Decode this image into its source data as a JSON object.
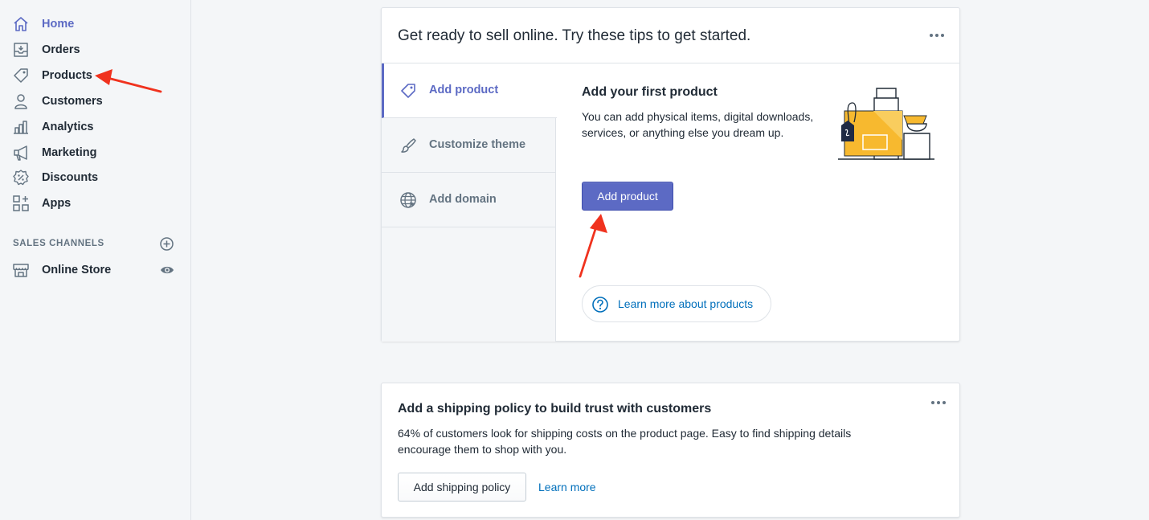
{
  "sidebar": {
    "items": [
      {
        "label": "Home",
        "icon": "home-icon",
        "active": true
      },
      {
        "label": "Orders",
        "icon": "orders-icon"
      },
      {
        "label": "Products",
        "icon": "tag-icon"
      },
      {
        "label": "Customers",
        "icon": "person-icon"
      },
      {
        "label": "Analytics",
        "icon": "bar-chart-icon"
      },
      {
        "label": "Marketing",
        "icon": "megaphone-icon"
      },
      {
        "label": "Discounts",
        "icon": "discount-icon"
      },
      {
        "label": "Apps",
        "icon": "apps-icon"
      }
    ],
    "sales_channels": {
      "title": "SALES CHANNELS",
      "items": [
        {
          "label": "Online Store",
          "icon": "store-icon"
        }
      ]
    }
  },
  "setup_card": {
    "title": "Get ready to sell online. Try these tips to get started.",
    "tabs": [
      {
        "label": "Add product",
        "icon": "tag-icon",
        "active": true
      },
      {
        "label": "Customize theme",
        "icon": "paintbrush-icon"
      },
      {
        "label": "Add domain",
        "icon": "globe-icon"
      }
    ],
    "panel": {
      "title": "Add your first product",
      "description": "You can add physical items, digital downloads, services, or anything else you dream up.",
      "primary_button": "Add product",
      "learn_more": "Learn more about products"
    }
  },
  "shipping_card": {
    "title": "Add a shipping policy to build trust with customers",
    "description": "64% of customers look for shipping costs on the product page. Easy to find shipping details encourage them to shop with you.",
    "button": "Add shipping policy",
    "link": "Learn more"
  },
  "colors": {
    "accent": "#5c6ac4",
    "link": "#006fbb",
    "annotation_arrow": "#f0321e",
    "illustration_yellow": "#f7b92f"
  }
}
